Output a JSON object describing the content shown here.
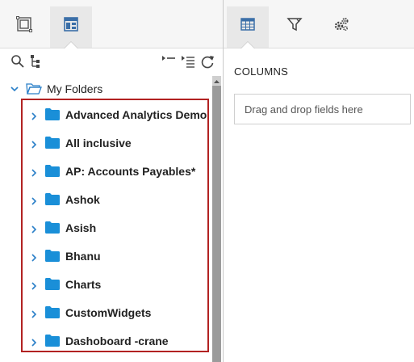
{
  "left_panel": {
    "tabs": [
      {
        "icon": "report-layout-icon"
      },
      {
        "icon": "dashboard-layout-icon",
        "active": true
      }
    ],
    "toolbar": {
      "left_icons": [
        "search-icon",
        "tree-view-icon"
      ],
      "right_icons": [
        "collapse-list-icon",
        "expand-list-icon",
        "refresh-icon"
      ]
    },
    "tree": {
      "root_label": "My Folders",
      "items": [
        {
          "label": "Advanced Analytics Demo"
        },
        {
          "label": "All inclusive"
        },
        {
          "label": "AP: Accounts Payables*"
        },
        {
          "label": "Ashok"
        },
        {
          "label": "Asish"
        },
        {
          "label": "Bhanu"
        },
        {
          "label": "Charts"
        },
        {
          "label": "CustomWidgets"
        },
        {
          "label": "Dashoboard -crane"
        }
      ]
    }
  },
  "right_panel": {
    "tabs": [
      {
        "icon": "table-icon",
        "active": true
      },
      {
        "icon": "filter-icon"
      },
      {
        "icon": "settings-gears-icon"
      }
    ],
    "columns_title": "COLUMNS",
    "dropzone_placeholder": "Drag and drop fields here"
  },
  "colors": {
    "folder_blue": "#1a8fd8",
    "chevron_blue": "#2a7fc8",
    "selection_red": "#b22222"
  }
}
